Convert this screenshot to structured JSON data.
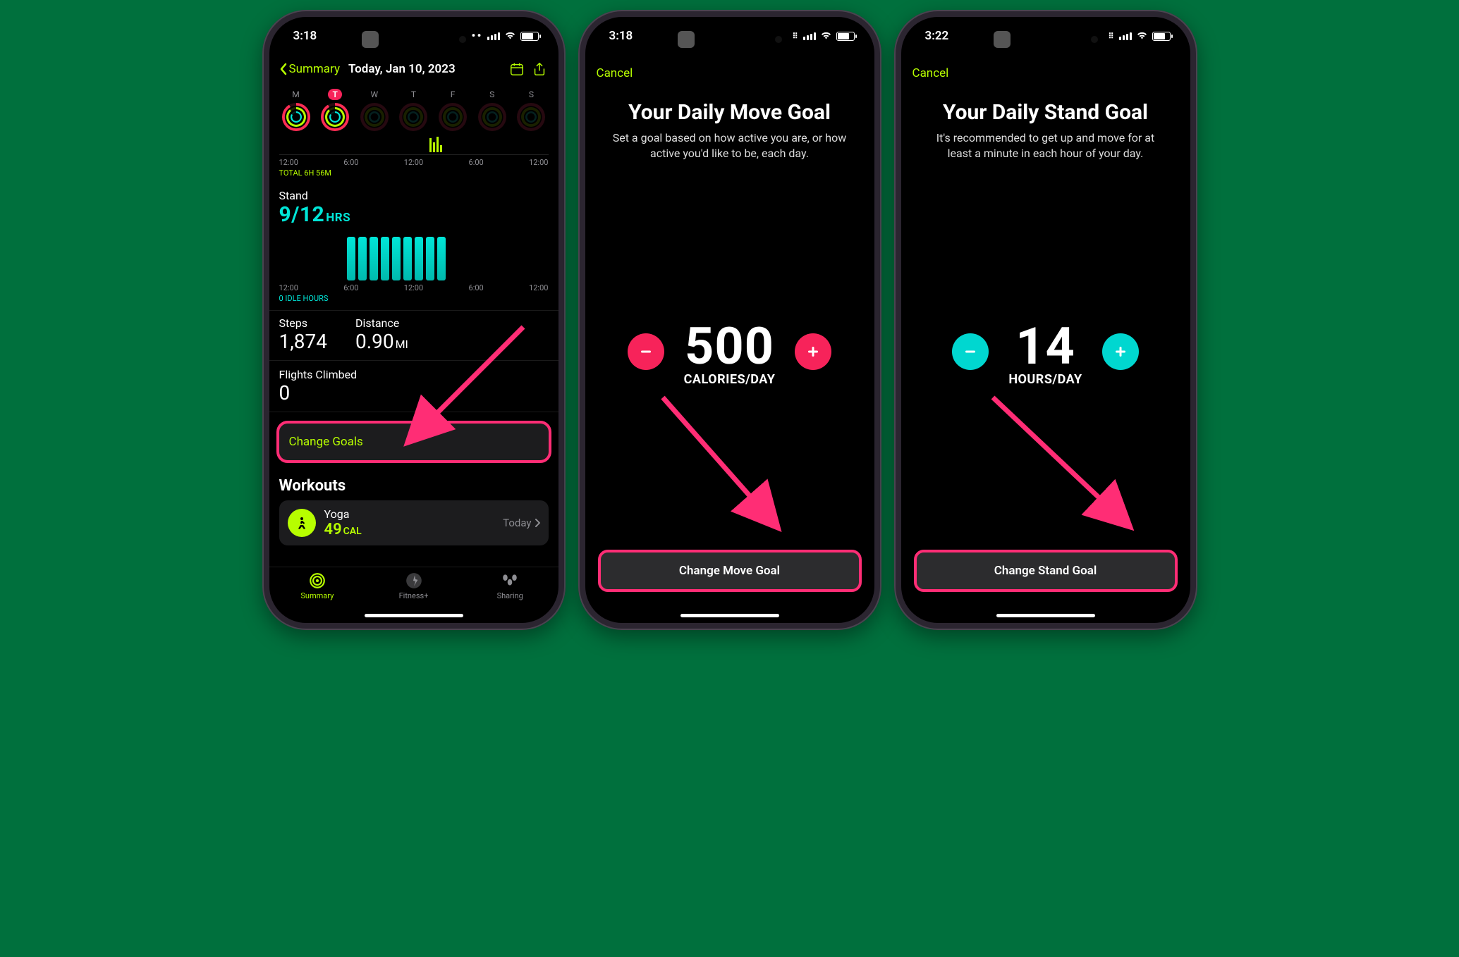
{
  "status": {
    "time1": "3:18",
    "time2": "3:18",
    "time3": "3:22"
  },
  "s1": {
    "back_label": "Summary",
    "date": "Today, Jan 10, 2023",
    "weekdays": [
      "M",
      "T",
      "W",
      "T",
      "F",
      "S",
      "S"
    ],
    "axis": [
      "12:00",
      "6:00",
      "12:00",
      "6:00",
      "12:00"
    ],
    "total_label": "TOTAL 6H 56M",
    "stand_label": "Stand",
    "stand_value": "9/12",
    "stand_unit": "HRS",
    "stand_axis": [
      "12:00",
      "6:00",
      "12:00",
      "6:00",
      "12:00"
    ],
    "idle_label": "0 IDLE HOURS",
    "steps_label": "Steps",
    "steps_value": "1,874",
    "distance_label": "Distance",
    "distance_value": "0.90",
    "distance_unit": "MI",
    "flights_label": "Flights Climbed",
    "flights_value": "0",
    "change_goals": "Change Goals",
    "workouts_header": "Workouts",
    "workout_name": "Yoga",
    "workout_value": "49",
    "workout_unit": "CAL",
    "workout_when": "Today",
    "tabs": {
      "summary": "Summary",
      "fitness": "Fitness+",
      "sharing": "Sharing"
    }
  },
  "s2": {
    "cancel": "Cancel",
    "title": "Your Daily Move Goal",
    "desc": "Set a goal based on how active you are, or how active you'd like to be, each day.",
    "value": "500",
    "unit": "CALORIES/DAY",
    "button": "Change Move Goal"
  },
  "s3": {
    "cancel": "Cancel",
    "title": "Your Daily Stand Goal",
    "desc": "It's recommended to get up and move for at least a minute in each hour of your day.",
    "value": "14",
    "unit": "HOURS/DAY",
    "button": "Change Stand Goal"
  }
}
